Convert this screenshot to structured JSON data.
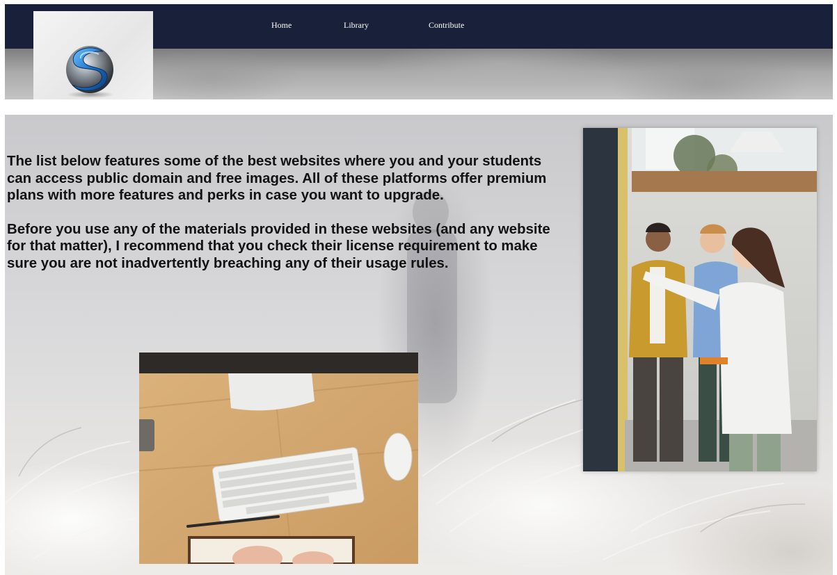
{
  "nav": {
    "items": [
      {
        "label": "Home"
      },
      {
        "label": "Library"
      },
      {
        "label": "Contribute"
      }
    ]
  },
  "main": {
    "paragraphs": [
      "The list below features some of the best websites where you and your students can access public domain and free images. All of these platforms offer premium plans with more features and perks in case you want to upgrade.",
      "Before you use any of the materials provided in these websites (and any website for that matter), I recommend that you check their license requirement to make sure you are not inadvertently breaching any of their usage rules."
    ]
  },
  "icons": {
    "logo": "s-globe-logo-icon"
  },
  "colors": {
    "nav_bar": "#18203a",
    "nav_text": "#ffffff",
    "body_text": "#121212",
    "logo_blue": "#1e73c9"
  }
}
